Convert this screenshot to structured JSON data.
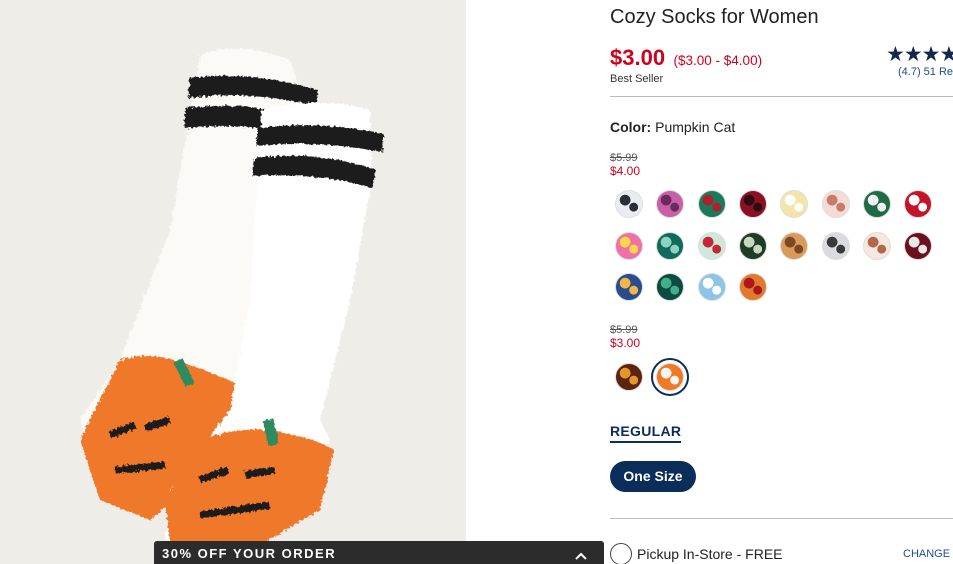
{
  "product": {
    "title": "Cozy Socks for Women",
    "price": "$3.00",
    "price_range": "($3.00 - $4.00)",
    "badge": "Best Seller",
    "rating_stars": "★★★★",
    "rating_value": 4.7,
    "reviews": "(4.7) 51 Re"
  },
  "color": {
    "label": "Color:",
    "value": "Pumpkin Cat"
  },
  "price_groups": [
    {
      "old_price": "$5.99",
      "new_price": "$4.00",
      "swatches": [
        {
          "name": "penguin",
          "colors": [
            "#e9edf2",
            "#2a2f3a"
          ]
        },
        {
          "name": "flamingo",
          "colors": [
            "#c95fa6",
            "#6b2a5e"
          ]
        },
        {
          "name": "green-plaid-gift",
          "colors": [
            "#1b7a5a",
            "#b01f2a"
          ]
        },
        {
          "name": "red-plaid",
          "colors": [
            "#8a1022",
            "#2c0c10"
          ]
        },
        {
          "name": "polar-bear",
          "colors": [
            "#f3e5a8",
            "#ffffff"
          ]
        },
        {
          "name": "pink-animals",
          "colors": [
            "#f4dcd6",
            "#c97a6a"
          ]
        },
        {
          "name": "green-gingerbread",
          "colors": [
            "#1e6b46",
            "#f2f2f2"
          ]
        },
        {
          "name": "red-dots",
          "colors": [
            "#c4142a",
            "#ffffff"
          ]
        },
        {
          "name": "pink-letters",
          "colors": [
            "#f070a8",
            "#ffd84a"
          ]
        },
        {
          "name": "green-cactus",
          "colors": [
            "#0f6b5a",
            "#8fd1c0"
          ]
        },
        {
          "name": "snowman",
          "colors": [
            "#cfe8dc",
            "#c82638"
          ]
        },
        {
          "name": "dark-green-tree",
          "colors": [
            "#1f3d25",
            "#c8d7c0"
          ]
        },
        {
          "name": "cookie",
          "colors": [
            "#d99a5a",
            "#7a4a24"
          ]
        },
        {
          "name": "gray-dog",
          "colors": [
            "#d9dbde",
            "#3a3a3a"
          ]
        },
        {
          "name": "cream-pattern",
          "colors": [
            "#f3e9df",
            "#b5674a"
          ]
        },
        {
          "name": "burgundy-stripe",
          "colors": [
            "#6c1020",
            "#e8e8e8"
          ]
        },
        {
          "name": "blue-cat",
          "colors": [
            "#2a4b8c",
            "#f2b74a"
          ]
        },
        {
          "name": "teal-leopard",
          "colors": [
            "#0d4a3f",
            "#3fb08a"
          ]
        },
        {
          "name": "light-blue",
          "colors": [
            "#8cc5e8",
            "#ffffff"
          ]
        },
        {
          "name": "pizza",
          "colors": [
            "#e07a2c",
            "#b0151e"
          ]
        }
      ]
    },
    {
      "old_price": "$5.99",
      "new_price": "$3.00",
      "swatches": [
        {
          "name": "autumn-leaves",
          "colors": [
            "#5c2410",
            "#e5962a"
          ]
        },
        {
          "name": "pumpkin-cat",
          "colors": [
            "#f07a24",
            "#f4f4f4"
          ],
          "selected": true
        }
      ]
    }
  ],
  "fit": {
    "tab": "REGULAR"
  },
  "size": {
    "button": "One Size"
  },
  "pickup": {
    "label": "Pickup In-Store - FREE",
    "change_store": "CHANGE S"
  },
  "promo": {
    "text": "30% OFF YOUR ORDER"
  },
  "colors": {
    "brand_navy": "#0b2d5a",
    "sale_red": "#d0021b",
    "link_blue": "#1f4b8e",
    "star_navy": "#13294b"
  }
}
